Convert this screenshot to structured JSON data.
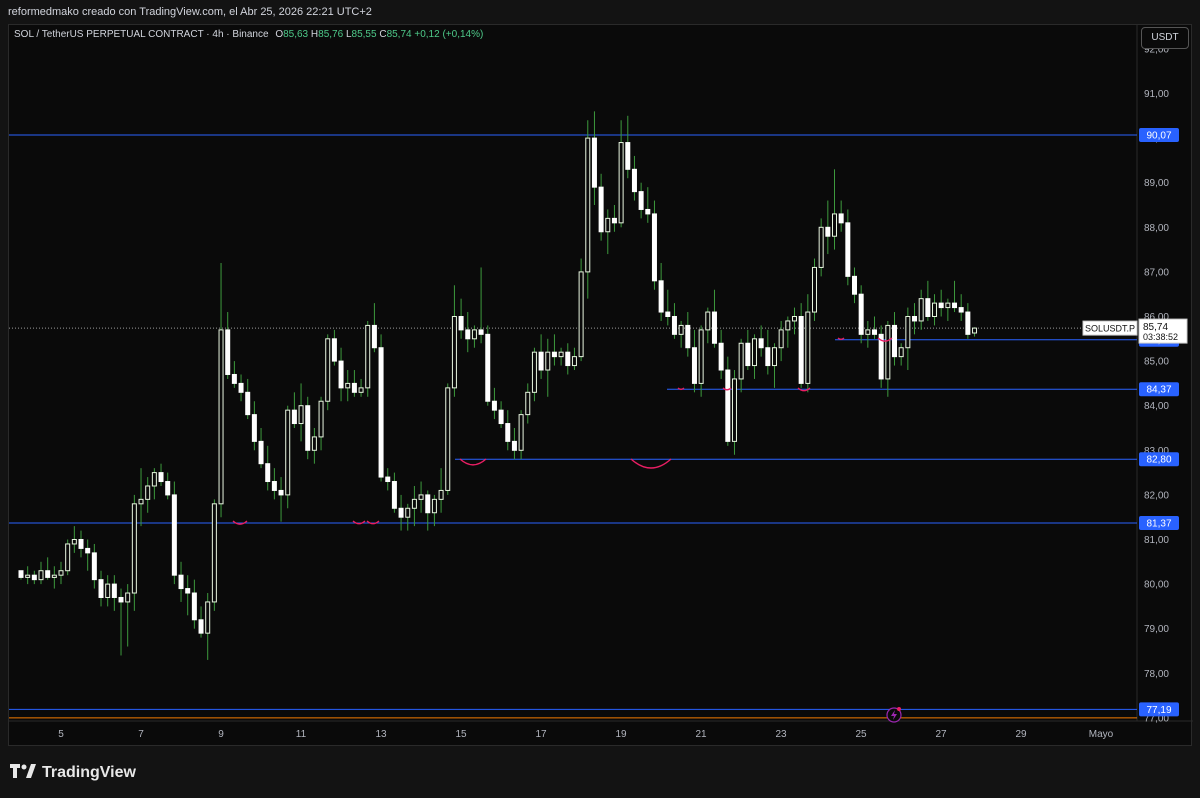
{
  "attribution": "reformedmako creado con TradingView.com, el Abr 25, 2026 22:21 UTC+2",
  "legend": {
    "symbol": "SOL / TetherUS PERPETUAL CONTRACT · 4h · Binance",
    "o_label": "O",
    "o": "85,63",
    "h_label": "H",
    "h": "85,76",
    "l_label": "L",
    "l": "85,55",
    "c_label": "C",
    "c": "85,74",
    "change": "+0,12 (+0,14%)"
  },
  "currency": "USDT",
  "brand": "TradingView",
  "colors": {
    "up": "#e8f5e0",
    "down": "#ffffff",
    "wick": "#3d9a3d",
    "level": "#2962ff",
    "label_bg": "#2962ff",
    "orange": "#f57c00",
    "marker": "#e91e63"
  },
  "chart_data": {
    "type": "candlestick",
    "symbol_label": "SOLUSDT.P",
    "last_price": "85,74",
    "countdown": "03:38:52",
    "ylim": [
      76.8,
      92.0
    ],
    "y_ticks": [
      "77,00",
      "78,00",
      "79,00",
      "80,00",
      "81,00",
      "82,00",
      "83,00",
      "84,00",
      "85,00",
      "86,00",
      "87,00",
      "88,00",
      "89,00",
      "90,00",
      "91,00",
      "92,00"
    ],
    "x_ticks": [
      "5",
      "7",
      "9",
      "11",
      "13",
      "15",
      "17",
      "19",
      "21",
      "23",
      "25",
      "27",
      "29",
      "Mayo"
    ],
    "x_tick_days": [
      5,
      7,
      9,
      11,
      13,
      15,
      17,
      19,
      21,
      23,
      25,
      27,
      29,
      31
    ],
    "levels": [
      {
        "value": 90.07,
        "label": "90,07"
      },
      {
        "value": 85.48,
        "label": "85,48"
      },
      {
        "value": 84.37,
        "label": "84,37"
      },
      {
        "value": 82.8,
        "label": "82,80"
      },
      {
        "value": 81.37,
        "label": "81,37"
      },
      {
        "value": 77.19,
        "label": "77,19"
      }
    ],
    "orange_level": 77.0,
    "start_day": 4.0,
    "candle_step_days": 0.1667,
    "candles": [
      [
        80.3,
        80.3,
        80.1,
        80.15
      ],
      [
        80.15,
        80.4,
        80.0,
        80.2
      ],
      [
        80.2,
        80.3,
        80.0,
        80.1
      ],
      [
        80.1,
        80.5,
        80.0,
        80.3
      ],
      [
        80.3,
        80.6,
        80.1,
        80.15
      ],
      [
        80.15,
        80.4,
        79.9,
        80.2
      ],
      [
        80.2,
        80.5,
        80.0,
        80.3
      ],
      [
        80.3,
        81.0,
        80.2,
        80.9
      ],
      [
        80.9,
        81.3,
        80.7,
        81.0
      ],
      [
        81.0,
        81.2,
        80.6,
        80.8
      ],
      [
        80.8,
        81.0,
        80.3,
        80.7
      ],
      [
        80.7,
        80.9,
        79.9,
        80.1
      ],
      [
        80.1,
        80.3,
        79.5,
        79.7
      ],
      [
        79.7,
        80.2,
        79.5,
        80.0
      ],
      [
        80.0,
        80.2,
        79.4,
        79.7
      ],
      [
        79.7,
        79.9,
        78.4,
        79.6
      ],
      [
        79.6,
        80.0,
        78.6,
        79.8
      ],
      [
        79.8,
        82.0,
        79.4,
        81.8
      ],
      [
        81.8,
        82.6,
        81.3,
        81.9
      ],
      [
        81.9,
        82.4,
        81.6,
        82.2
      ],
      [
        82.2,
        82.6,
        81.9,
        82.5
      ],
      [
        82.5,
        82.7,
        82.2,
        82.3
      ],
      [
        82.3,
        82.5,
        81.9,
        82.0
      ],
      [
        82.0,
        82.3,
        80.0,
        80.2
      ],
      [
        80.2,
        80.5,
        79.6,
        79.9
      ],
      [
        79.9,
        80.2,
        79.3,
        79.8
      ],
      [
        79.8,
        80.1,
        79.0,
        79.2
      ],
      [
        79.2,
        79.5,
        78.8,
        78.9
      ],
      [
        78.9,
        79.8,
        78.3,
        79.6
      ],
      [
        79.6,
        81.9,
        79.4,
        81.8
      ],
      [
        81.8,
        87.2,
        81.5,
        85.7
      ],
      [
        85.7,
        86.1,
        84.6,
        84.7
      ],
      [
        84.7,
        85.0,
        84.4,
        84.5
      ],
      [
        84.5,
        84.7,
        84.1,
        84.3
      ],
      [
        84.3,
        84.6,
        83.7,
        83.8
      ],
      [
        83.8,
        84.1,
        83.0,
        83.2
      ],
      [
        83.2,
        83.5,
        82.6,
        82.7
      ],
      [
        82.7,
        83.1,
        82.1,
        82.3
      ],
      [
        82.3,
        82.6,
        81.9,
        82.1
      ],
      [
        82.1,
        82.4,
        81.4,
        82.0
      ],
      [
        82.0,
        84.0,
        81.7,
        83.9
      ],
      [
        83.9,
        84.3,
        83.5,
        83.6
      ],
      [
        83.6,
        84.5,
        83.2,
        84.0
      ],
      [
        84.0,
        84.2,
        82.8,
        83.0
      ],
      [
        83.0,
        83.5,
        82.7,
        83.3
      ],
      [
        83.3,
        84.2,
        83.0,
        84.1
      ],
      [
        84.1,
        85.6,
        83.9,
        85.5
      ],
      [
        85.5,
        85.7,
        84.9,
        85.0
      ],
      [
        85.0,
        85.3,
        84.1,
        84.4
      ],
      [
        84.4,
        84.8,
        84.1,
        84.5
      ],
      [
        84.5,
        84.8,
        84.2,
        84.3
      ],
      [
        84.3,
        84.6,
        84.2,
        84.4
      ],
      [
        84.4,
        85.9,
        84.2,
        85.8
      ],
      [
        85.8,
        86.3,
        85.2,
        85.3
      ],
      [
        85.3,
        85.6,
        82.3,
        82.4
      ],
      [
        82.4,
        82.6,
        82.1,
        82.3
      ],
      [
        82.3,
        82.5,
        81.6,
        81.7
      ],
      [
        81.7,
        82.0,
        81.2,
        81.5
      ],
      [
        81.5,
        81.8,
        81.2,
        81.7
      ],
      [
        81.7,
        82.2,
        81.3,
        81.9
      ],
      [
        81.9,
        82.3,
        81.6,
        82.0
      ],
      [
        82.0,
        82.1,
        81.2,
        81.6
      ],
      [
        81.6,
        82.0,
        81.3,
        81.9
      ],
      [
        81.9,
        82.6,
        81.6,
        82.1
      ],
      [
        82.1,
        84.5,
        82.0,
        84.4
      ],
      [
        84.4,
        86.7,
        84.2,
        86.0
      ],
      [
        86.0,
        86.4,
        85.5,
        85.7
      ],
      [
        85.7,
        86.1,
        85.2,
        85.5
      ],
      [
        85.5,
        85.8,
        85.3,
        85.7
      ],
      [
        85.7,
        87.1,
        85.4,
        85.6
      ],
      [
        85.6,
        85.8,
        84.0,
        84.1
      ],
      [
        84.1,
        84.4,
        83.7,
        83.9
      ],
      [
        83.9,
        84.1,
        83.5,
        83.6
      ],
      [
        83.6,
        83.9,
        83.0,
        83.2
      ],
      [
        83.2,
        83.5,
        82.8,
        83.0
      ],
      [
        83.0,
        83.9,
        82.8,
        83.8
      ],
      [
        83.8,
        84.5,
        83.6,
        84.3
      ],
      [
        84.3,
        85.3,
        84.1,
        85.2
      ],
      [
        85.2,
        85.6,
        84.6,
        84.8
      ],
      [
        84.8,
        85.5,
        84.2,
        85.2
      ],
      [
        85.2,
        85.6,
        84.9,
        85.1
      ],
      [
        85.1,
        85.3,
        84.9,
        85.2
      ],
      [
        85.2,
        85.4,
        84.7,
        84.9
      ],
      [
        84.9,
        85.3,
        84.8,
        85.1
      ],
      [
        85.1,
        87.3,
        85.0,
        87.0
      ],
      [
        87.0,
        90.4,
        86.4,
        90.0
      ],
      [
        90.0,
        90.6,
        88.5,
        88.9
      ],
      [
        88.9,
        89.2,
        87.7,
        87.9
      ],
      [
        87.9,
        88.4,
        87.4,
        88.2
      ],
      [
        88.2,
        88.5,
        87.9,
        88.1
      ],
      [
        88.1,
        90.4,
        88.0,
        89.9
      ],
      [
        89.9,
        90.5,
        89.1,
        89.3
      ],
      [
        89.3,
        89.6,
        88.6,
        88.8
      ],
      [
        88.8,
        89.0,
        88.2,
        88.4
      ],
      [
        88.4,
        88.9,
        88.1,
        88.3
      ],
      [
        88.3,
        88.6,
        86.6,
        86.8
      ],
      [
        86.8,
        87.2,
        85.9,
        86.1
      ],
      [
        86.1,
        86.6,
        85.8,
        86.0
      ],
      [
        86.0,
        86.3,
        85.5,
        85.6
      ],
      [
        85.6,
        85.9,
        85.3,
        85.8
      ],
      [
        85.8,
        86.1,
        85.1,
        85.3
      ],
      [
        85.3,
        85.7,
        84.3,
        84.5
      ],
      [
        84.5,
        85.8,
        84.2,
        85.7
      ],
      [
        85.7,
        86.2,
        85.4,
        86.1
      ],
      [
        86.1,
        86.6,
        85.3,
        85.4
      ],
      [
        85.4,
        85.7,
        84.6,
        84.8
      ],
      [
        84.8,
        85.1,
        83.1,
        83.2
      ],
      [
        83.2,
        84.8,
        82.9,
        84.6
      ],
      [
        84.6,
        85.5,
        84.3,
        85.4
      ],
      [
        85.4,
        85.7,
        84.8,
        84.9
      ],
      [
        84.9,
        85.6,
        84.6,
        85.5
      ],
      [
        85.5,
        85.8,
        85.1,
        85.3
      ],
      [
        85.3,
        85.7,
        84.7,
        84.9
      ],
      [
        84.9,
        85.4,
        84.4,
        85.3
      ],
      [
        85.3,
        85.9,
        85.0,
        85.7
      ],
      [
        85.7,
        86.0,
        85.3,
        85.9
      ],
      [
        85.9,
        86.2,
        85.6,
        86.0
      ],
      [
        86.0,
        86.3,
        84.4,
        84.5
      ],
      [
        84.5,
        86.5,
        84.3,
        86.1
      ],
      [
        86.1,
        87.3,
        85.9,
        87.1
      ],
      [
        87.1,
        88.2,
        86.9,
        88.0
      ],
      [
        88.0,
        88.6,
        87.4,
        87.8
      ],
      [
        87.8,
        89.3,
        87.5,
        88.3
      ],
      [
        88.3,
        88.6,
        87.9,
        88.1
      ],
      [
        88.1,
        88.4,
        86.7,
        86.9
      ],
      [
        86.9,
        87.1,
        86.3,
        86.5
      ],
      [
        86.5,
        86.7,
        85.4,
        85.6
      ],
      [
        85.6,
        85.9,
        85.3,
        85.7
      ],
      [
        85.7,
        86.0,
        85.5,
        85.6
      ],
      [
        85.6,
        85.8,
        84.4,
        84.6
      ],
      [
        84.6,
        85.9,
        84.2,
        85.8
      ],
      [
        85.8,
        86.1,
        84.9,
        85.1
      ],
      [
        85.1,
        85.4,
        84.9,
        85.3
      ],
      [
        85.3,
        86.2,
        84.8,
        86.0
      ],
      [
        86.0,
        86.3,
        85.6,
        85.9
      ],
      [
        85.9,
        86.6,
        85.7,
        86.4
      ],
      [
        86.4,
        86.8,
        85.9,
        86.0
      ],
      [
        86.0,
        86.5,
        85.8,
        86.3
      ],
      [
        86.3,
        86.6,
        86.0,
        86.2
      ],
      [
        86.2,
        86.4,
        85.9,
        86.3
      ],
      [
        86.3,
        86.8,
        86.1,
        86.2
      ],
      [
        86.2,
        86.5,
        85.9,
        86.1
      ],
      [
        86.1,
        86.3,
        85.5,
        85.6
      ],
      [
        85.63,
        85.76,
        85.55,
        85.74
      ]
    ]
  }
}
